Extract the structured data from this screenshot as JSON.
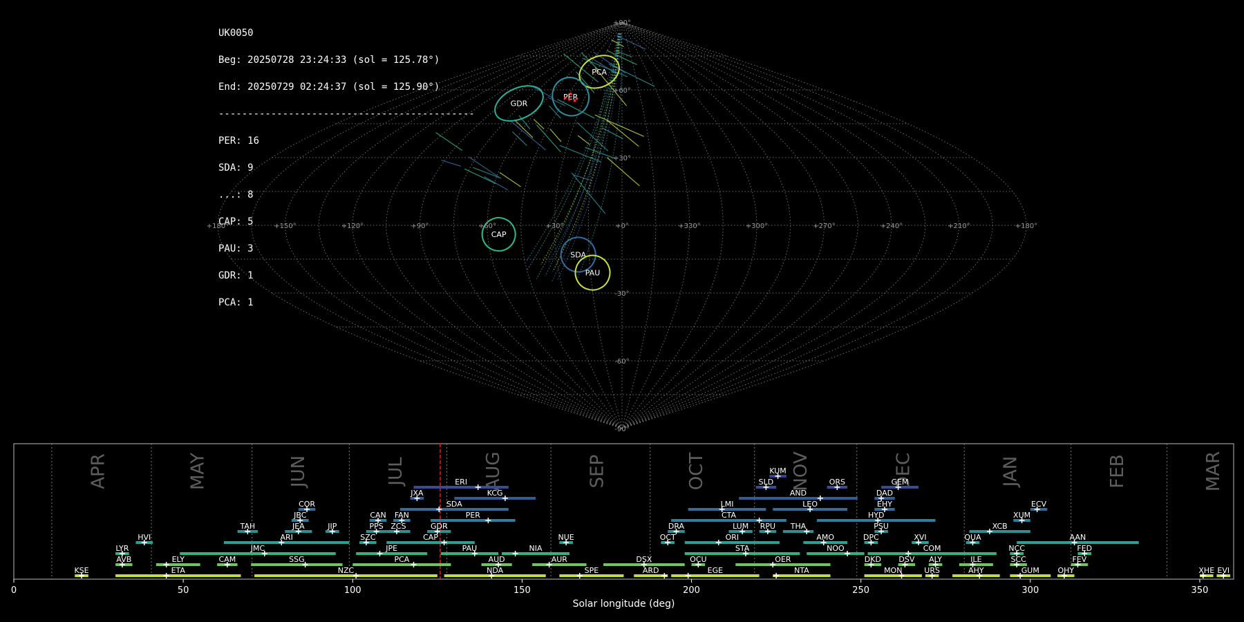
{
  "header": {
    "station": "UK0050",
    "beg": "Beg: 20250728 23:24:33 (sol = 125.78°)",
    "end": "End: 20250729 02:24:37 (sol = 125.90°)",
    "separator": "--------------------------------------------",
    "counts": [
      "PER: 16",
      "SDA: 9",
      "...: 8",
      "CAP: 5",
      "PAU: 3",
      "GDR: 1",
      "PCA: 1"
    ]
  },
  "sky_map": {
    "projection": "sinusoidal",
    "lon_labels": [
      "+180°",
      "+150°",
      "+120°",
      "+90°",
      "+60°",
      "+30°",
      "+0°",
      "+330°",
      "+300°",
      "+270°",
      "+240°",
      "+210°",
      "+180°"
    ],
    "lat_labels": [
      "+90°",
      "+60°",
      "+30°",
      "-30°",
      "-60°",
      "-90°"
    ],
    "radiants": [
      {
        "code": "PCA",
        "lon": -27,
        "lat": 68,
        "color": "#c6e23c"
      },
      {
        "code": "PER",
        "lon": -42,
        "lat": 57,
        "color": "#2a8f9f"
      },
      {
        "code": "GDR",
        "lon": -78,
        "lat": 54,
        "color": "#2db09a"
      },
      {
        "code": "CAP",
        "lon": -55,
        "lat": -4,
        "color": "#2fb68c"
      },
      {
        "code": "SDA",
        "lon": -20,
        "lat": -13,
        "color": "#2f6fa3"
      },
      {
        "code": "PAU",
        "lon": -14,
        "lat": -21,
        "color": "#c6e23c"
      }
    ]
  },
  "chart_data": {
    "type": "gantt",
    "title": "",
    "xlabel": "Solar longitude (deg)",
    "xlim": [
      0,
      360
    ],
    "xticks": [
      0,
      50,
      100,
      150,
      200,
      250,
      300,
      350
    ],
    "current_sol": 125.84,
    "months": [
      {
        "name": "APR",
        "start": 11.2
      },
      {
        "name": "MAY",
        "start": 40.6
      },
      {
        "name": "JUN",
        "start": 70.3
      },
      {
        "name": "JUL",
        "start": 99.0
      },
      {
        "name": "AUG",
        "start": 127.8
      },
      {
        "name": "SEP",
        "start": 158.5
      },
      {
        "name": "OCT",
        "start": 187.8
      },
      {
        "name": "NOV",
        "start": 218.6
      },
      {
        "name": "DEC",
        "start": 248.8
      },
      {
        "name": "JAN",
        "start": 280.5
      },
      {
        "name": "FEB",
        "start": 312.0
      },
      {
        "name": "MAR",
        "start": 340.3
      }
    ],
    "showers": [
      {
        "code": "KUM",
        "start": 223,
        "end": 228,
        "peak": 225.5,
        "row": 9,
        "color": "#3a3f94"
      },
      {
        "code": "ERI",
        "start": 118,
        "end": 146,
        "peak": 137,
        "row": 8,
        "color": "#3b4a95"
      },
      {
        "code": "SLD",
        "start": 219,
        "end": 225,
        "peak": 222,
        "row": 8,
        "color": "#3b4a95"
      },
      {
        "code": "ORS",
        "start": 240,
        "end": 246,
        "peak": 243,
        "row": 8,
        "color": "#3b4a95"
      },
      {
        "code": "GEM",
        "start": 256,
        "end": 267,
        "peak": 261,
        "row": 8,
        "color": "#3b4a95"
      },
      {
        "code": "JXA",
        "start": 117,
        "end": 121,
        "peak": 119,
        "row": 7,
        "color": "#355b97"
      },
      {
        "code": "KCG",
        "start": 130,
        "end": 154,
        "peak": 145,
        "row": 7,
        "color": "#355b97"
      },
      {
        "code": "AND",
        "start": 214,
        "end": 249,
        "peak": 238,
        "row": 7,
        "color": "#355b97"
      },
      {
        "code": "DAD",
        "start": 254,
        "end": 260,
        "peak": 256,
        "row": 7,
        "color": "#355b97"
      },
      {
        "code": "COR",
        "start": 84,
        "end": 89,
        "peak": 86.5,
        "row": 6,
        "color": "#336c9a"
      },
      {
        "code": "SDA",
        "start": 114,
        "end": 146,
        "peak": 125.5,
        "row": 6,
        "color": "#336c9a"
      },
      {
        "code": "LMI",
        "start": 199,
        "end": 222,
        "peak": 209,
        "row": 6,
        "color": "#336c9a"
      },
      {
        "code": "LEO",
        "start": 224,
        "end": 246,
        "peak": 235,
        "row": 6,
        "color": "#336c9a"
      },
      {
        "code": "EHY",
        "start": 254,
        "end": 260,
        "peak": 257,
        "row": 6,
        "color": "#336c9a"
      },
      {
        "code": "ECV",
        "start": 300,
        "end": 305,
        "peak": 302,
        "row": 6,
        "color": "#336c9a"
      },
      {
        "code": "JBC",
        "start": 82,
        "end": 87,
        "peak": 84.5,
        "row": 5,
        "color": "#2f7f9c"
      },
      {
        "code": "CAN",
        "start": 105,
        "end": 110,
        "peak": 107.5,
        "row": 5,
        "color": "#2f7f9c"
      },
      {
        "code": "FAN",
        "start": 112,
        "end": 117,
        "peak": 114.5,
        "row": 5,
        "color": "#2f7f9c"
      },
      {
        "code": "PER",
        "start": 123,
        "end": 148,
        "peak": 140,
        "row": 5,
        "color": "#2f7f9c"
      },
      {
        "code": "CTA",
        "start": 194,
        "end": 228,
        "peak": 220,
        "row": 5,
        "color": "#2f7f9c"
      },
      {
        "code": "HYD",
        "start": 237,
        "end": 272,
        "peak": 255,
        "row": 5,
        "color": "#2f7f9c"
      },
      {
        "code": "XUM",
        "start": 295,
        "end": 300,
        "peak": 297.5,
        "row": 5,
        "color": "#2f7f9c"
      },
      {
        "code": "TAH",
        "start": 66,
        "end": 72,
        "peak": 69,
        "row": 4,
        "color": "#2a919b"
      },
      {
        "code": "JEA",
        "start": 80,
        "end": 88,
        "peak": 84,
        "row": 4,
        "color": "#2a919b"
      },
      {
        "code": "JIP",
        "start": 92,
        "end": 96,
        "peak": 94,
        "row": 4,
        "color": "#2a919b"
      },
      {
        "code": "PPS",
        "start": 104,
        "end": 110,
        "peak": 107,
        "row": 4,
        "color": "#2a919b"
      },
      {
        "code": "ZCS",
        "start": 110,
        "end": 117,
        "peak": 113,
        "row": 4,
        "color": "#2a919b"
      },
      {
        "code": "GDR",
        "start": 122,
        "end": 129,
        "peak": 125,
        "row": 4,
        "color": "#2a919b"
      },
      {
        "code": "DRA",
        "start": 193,
        "end": 198,
        "peak": 195.5,
        "row": 4,
        "color": "#2a919b"
      },
      {
        "code": "LUM",
        "start": 211,
        "end": 218,
        "peak": 215,
        "row": 4,
        "color": "#2a919b"
      },
      {
        "code": "RPU",
        "start": 220,
        "end": 225,
        "peak": 222.5,
        "row": 4,
        "color": "#2a919b"
      },
      {
        "code": "THA",
        "start": 227,
        "end": 236,
        "peak": 234,
        "row": 4,
        "color": "#2a919b"
      },
      {
        "code": "PSU",
        "start": 254,
        "end": 258,
        "peak": 256,
        "row": 4,
        "color": "#2a919b"
      },
      {
        "code": "XCB",
        "start": 282,
        "end": 300,
        "peak": 288,
        "row": 4,
        "color": "#2a919b"
      },
      {
        "code": "HVI",
        "start": 36,
        "end": 41,
        "peak": 38.5,
        "row": 3,
        "color": "#27a394"
      },
      {
        "code": "ARI",
        "start": 62,
        "end": 99,
        "peak": 79,
        "row": 3,
        "color": "#27a394"
      },
      {
        "code": "SZC",
        "start": 102,
        "end": 107,
        "peak": 104,
        "row": 3,
        "color": "#27a394"
      },
      {
        "code": "CAP",
        "start": 110,
        "end": 136,
        "peak": 127,
        "row": 3,
        "color": "#27a394"
      },
      {
        "code": "NUE",
        "start": 161,
        "end": 165,
        "peak": 163,
        "row": 3,
        "color": "#27a394"
      },
      {
        "code": "OCT",
        "start": 191,
        "end": 195,
        "peak": 193,
        "row": 3,
        "color": "#27a394"
      },
      {
        "code": "ORI",
        "start": 198,
        "end": 226,
        "peak": 208,
        "row": 3,
        "color": "#27a394"
      },
      {
        "code": "AMO",
        "start": 233,
        "end": 246,
        "peak": 239,
        "row": 3,
        "color": "#27a394"
      },
      {
        "code": "DPC",
        "start": 251,
        "end": 255,
        "peak": 253,
        "row": 3,
        "color": "#27a394"
      },
      {
        "code": "XVI",
        "start": 265,
        "end": 270,
        "peak": 267,
        "row": 3,
        "color": "#27a394"
      },
      {
        "code": "QUA",
        "start": 281,
        "end": 285,
        "peak": 283,
        "row": 3,
        "color": "#27a394"
      },
      {
        "code": "AAN",
        "start": 296,
        "end": 332,
        "peak": 313,
        "row": 3,
        "color": "#27a394"
      },
      {
        "code": "LYR",
        "start": 30,
        "end": 34,
        "peak": 32,
        "row": 2,
        "color": "#2fb582"
      },
      {
        "code": "JMC",
        "start": 49,
        "end": 95,
        "peak": 74,
        "row": 2,
        "color": "#2fb582"
      },
      {
        "code": "JPE",
        "start": 101,
        "end": 122,
        "peak": 108,
        "row": 2,
        "color": "#2fb582"
      },
      {
        "code": "PAU",
        "start": 126,
        "end": 143,
        "peak": 136,
        "row": 2,
        "color": "#2fb582"
      },
      {
        "code": "NIA",
        "start": 144,
        "end": 164,
        "peak": 148,
        "row": 2,
        "color": "#2fb582"
      },
      {
        "code": "STA",
        "start": 198,
        "end": 232,
        "peak": 216,
        "row": 2,
        "color": "#2fb582"
      },
      {
        "code": "NOO",
        "start": 234,
        "end": 251,
        "peak": 246,
        "row": 2,
        "color": "#2fb582"
      },
      {
        "code": "COM",
        "start": 252,
        "end": 290,
        "peak": 264,
        "row": 2,
        "color": "#2fb582"
      },
      {
        "code": "NCC",
        "start": 294,
        "end": 298,
        "peak": 296,
        "row": 2,
        "color": "#2fb582"
      },
      {
        "code": "FED",
        "start": 314,
        "end": 318,
        "peak": 316,
        "row": 2,
        "color": "#2fb582"
      },
      {
        "code": "AVB",
        "start": 30,
        "end": 35,
        "peak": 32,
        "row": 1,
        "color": "#6cc85a"
      },
      {
        "code": "ELY",
        "start": 42,
        "end": 55,
        "peak": 45,
        "row": 1,
        "color": "#6cc85a"
      },
      {
        "code": "CAM",
        "start": 60,
        "end": 66,
        "peak": 63,
        "row": 1,
        "color": "#6cc85a"
      },
      {
        "code": "SSG",
        "start": 70,
        "end": 97,
        "peak": 86,
        "row": 1,
        "color": "#6cc85a"
      },
      {
        "code": "PCA",
        "start": 100,
        "end": 129,
        "peak": 118,
        "row": 1,
        "color": "#6cc85a"
      },
      {
        "code": "AUD",
        "start": 138,
        "end": 147,
        "peak": 143,
        "row": 1,
        "color": "#6cc85a"
      },
      {
        "code": "AUR",
        "start": 153,
        "end": 169,
        "peak": 158,
        "row": 1,
        "color": "#6cc85a"
      },
      {
        "code": "DSX",
        "start": 174,
        "end": 198,
        "peak": 186,
        "row": 1,
        "color": "#6cc85a"
      },
      {
        "code": "OCU",
        "start": 200,
        "end": 204,
        "peak": 202,
        "row": 1,
        "color": "#6cc85a"
      },
      {
        "code": "OER",
        "start": 213,
        "end": 241,
        "peak": 224,
        "row": 1,
        "color": "#6cc85a"
      },
      {
        "code": "DKD",
        "start": 251,
        "end": 256,
        "peak": 253,
        "row": 1,
        "color": "#6cc85a"
      },
      {
        "code": "DSV",
        "start": 261,
        "end": 266,
        "peak": 263,
        "row": 1,
        "color": "#6cc85a"
      },
      {
        "code": "ALY",
        "start": 270,
        "end": 274,
        "peak": 272,
        "row": 1,
        "color": "#6cc85a"
      },
      {
        "code": "ILE",
        "start": 279,
        "end": 289,
        "peak": 283,
        "row": 1,
        "color": "#6cc85a"
      },
      {
        "code": "SCC",
        "start": 294,
        "end": 299,
        "peak": 296,
        "row": 1,
        "color": "#6cc85a"
      },
      {
        "code": "FEV",
        "start": 312,
        "end": 317,
        "peak": 314,
        "row": 1,
        "color": "#6cc85a"
      },
      {
        "code": "KSE",
        "start": 18,
        "end": 22,
        "peak": 20,
        "row": 0,
        "color": "#c1dd3c"
      },
      {
        "code": "ETA",
        "start": 30,
        "end": 67,
        "peak": 45,
        "row": 0,
        "color": "#c1dd3c"
      },
      {
        "code": "NZC",
        "start": 71,
        "end": 125,
        "peak": 101,
        "row": 0,
        "color": "#c1dd3c"
      },
      {
        "code": "NDA",
        "start": 127,
        "end": 157,
        "peak": 141,
        "row": 0,
        "color": "#c1dd3c"
      },
      {
        "code": "SPE",
        "start": 161,
        "end": 180,
        "peak": 167,
        "row": 0,
        "color": "#c1dd3c"
      },
      {
        "code": "ARD",
        "start": 183,
        "end": 193,
        "peak": 192,
        "row": 0,
        "color": "#c1dd3c"
      },
      {
        "code": "EGE",
        "start": 194,
        "end": 220,
        "peak": 199,
        "row": 0,
        "color": "#c1dd3c"
      },
      {
        "code": "NTA",
        "start": 224,
        "end": 241,
        "peak": 225,
        "row": 0,
        "color": "#c1dd3c"
      },
      {
        "code": "MON",
        "start": 251,
        "end": 268,
        "peak": 262,
        "row": 0,
        "color": "#c1dd3c"
      },
      {
        "code": "URS",
        "start": 269,
        "end": 273,
        "peak": 271,
        "row": 0,
        "color": "#c1dd3c"
      },
      {
        "code": "AHY",
        "start": 277,
        "end": 291,
        "peak": 285,
        "row": 0,
        "color": "#c1dd3c"
      },
      {
        "code": "GUM",
        "start": 294,
        "end": 306,
        "peak": 297,
        "row": 0,
        "color": "#c1dd3c"
      },
      {
        "code": "OHY",
        "start": 308,
        "end": 313,
        "peak": 310,
        "row": 0,
        "color": "#c1dd3c"
      },
      {
        "code": "XHE",
        "start": 350,
        "end": 354,
        "peak": 351,
        "row": 0,
        "color": "#c1dd3c"
      },
      {
        "code": "EVI",
        "start": 355,
        "end": 359,
        "peak": 357,
        "row": 0,
        "color": "#c1dd3c"
      }
    ]
  }
}
